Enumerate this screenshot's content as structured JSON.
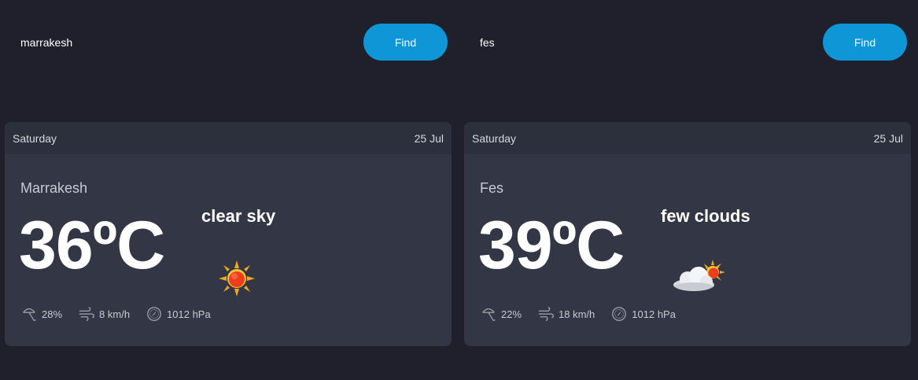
{
  "panels": [
    {
      "search": {
        "value": "marrakesh",
        "button_label": "Find"
      },
      "card": {
        "day": "Saturday",
        "date": "25 Jul",
        "city": "Marrakesh",
        "temperature": "36ºC",
        "condition": "clear sky",
        "icon": "sun-icon",
        "humidity": "28%",
        "wind": "8 km/h",
        "pressure": "1012 hPa"
      }
    },
    {
      "search": {
        "value": "fes",
        "button_label": "Find"
      },
      "card": {
        "day": "Saturday",
        "date": "25 Jul",
        "city": "Fes",
        "temperature": "39ºC",
        "condition": "few clouds",
        "icon": "cloud-sun-icon",
        "humidity": "22%",
        "wind": "18 km/h",
        "pressure": "1012 hPa"
      }
    }
  ],
  "colors": {
    "background": "#1f202c",
    "card": "#333644",
    "card_header": "#2c2f3c",
    "accent": "#0f96d6"
  }
}
